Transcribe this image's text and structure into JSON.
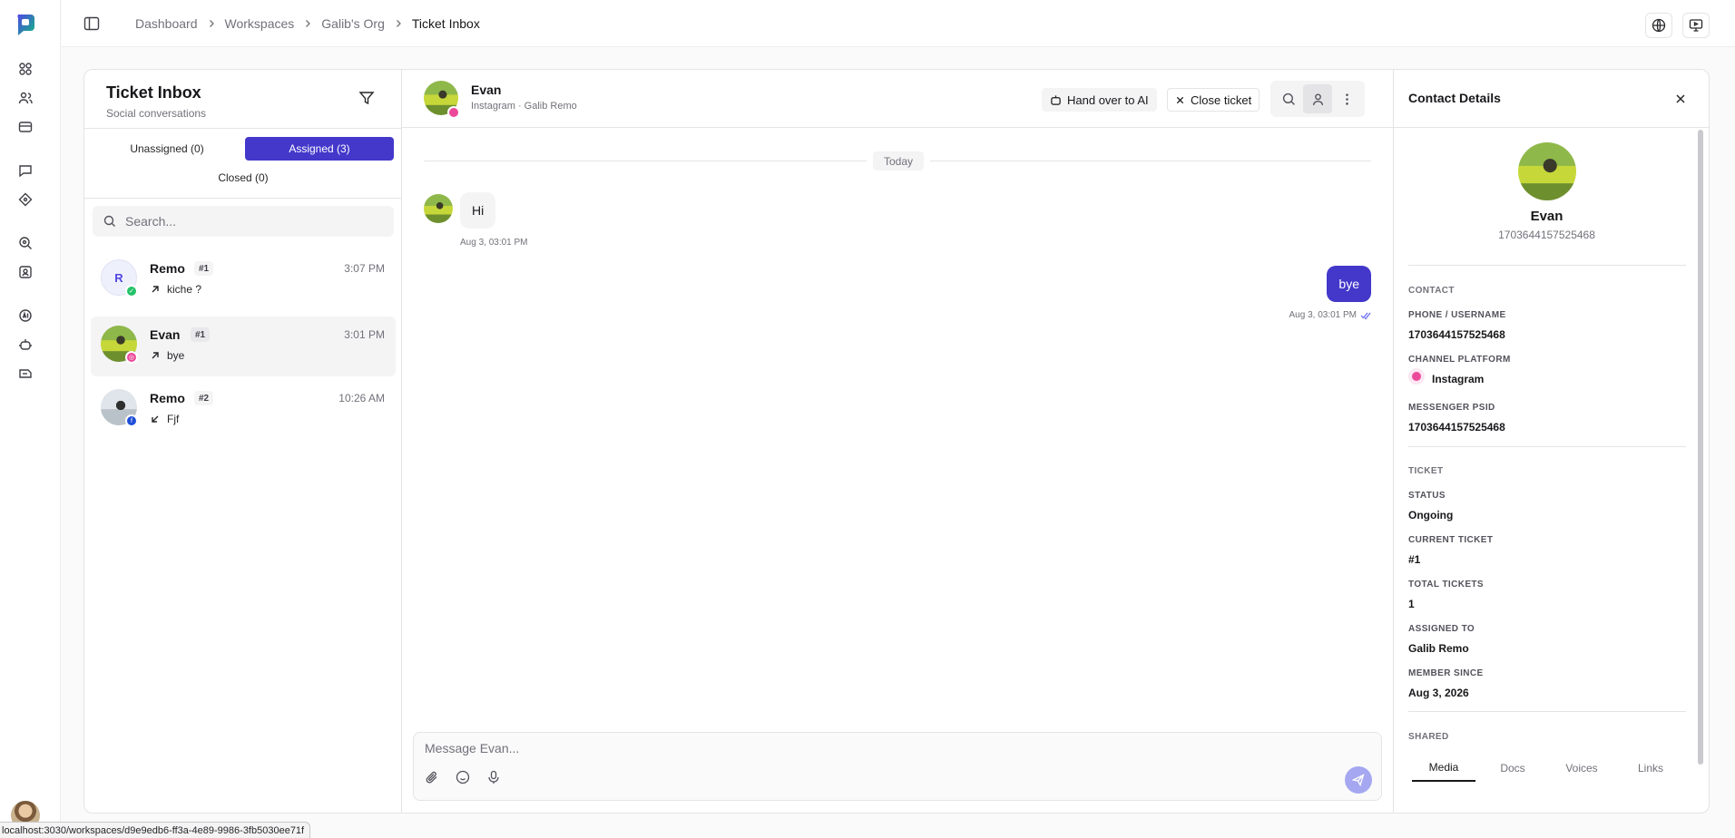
{
  "breadcrumbs": [
    "Dashboard",
    "Workspaces",
    "Galib's Org",
    "Ticket Inbox"
  ],
  "inbox": {
    "title": "Ticket Inbox",
    "subtitle": "Social conversations",
    "tabs": [
      "Unassigned (0)",
      "Assigned (3)",
      "Closed (0)"
    ],
    "active_tab": "Assigned (3)",
    "search_placeholder": "Search...",
    "conversations": [
      {
        "avatar_letter": "R",
        "name": "Remo",
        "ticket": "#1",
        "time": "3:07 PM",
        "preview": "kiche ?",
        "channel": "whatsapp",
        "direction": "outgoing"
      },
      {
        "avatar_letter": "",
        "name": "Evan",
        "ticket": "#1",
        "time": "3:01 PM",
        "preview": "bye",
        "channel": "instagram",
        "direction": "outgoing",
        "selected": true
      },
      {
        "avatar_letter": "",
        "name": "Remo",
        "ticket": "#2",
        "time": "10:26 AM",
        "preview": "Fjf",
        "channel": "facebook",
        "direction": "incoming"
      }
    ]
  },
  "chat": {
    "contact_name": "Evan",
    "contact_sub": "Instagram · Galib Remo",
    "hand_over_label": "Hand over to AI",
    "close_ticket_label": "Close ticket",
    "day_label": "Today",
    "messages": [
      {
        "direction": "in",
        "text": "Hi",
        "timestamp": "Aug 3, 03:01 PM"
      },
      {
        "direction": "out",
        "text": "bye",
        "timestamp": "Aug 3, 03:01 PM"
      }
    ],
    "composer_placeholder": "Message Evan..."
  },
  "details": {
    "title": "Contact Details",
    "name": "Evan",
    "id": "1703644157525468",
    "contact_section": "CONTACT",
    "phone_label": "PHONE / USERNAME",
    "phone_value": "1703644157525468",
    "platform_label": "CHANNEL PLATFORM",
    "platform_value": "Instagram",
    "psid_label": "MESSENGER PSID",
    "psid_value": "1703644157525468",
    "ticket_section": "TICKET",
    "status_label": "STATUS",
    "status_value": "Ongoing",
    "current_ticket_label": "CURRENT TICKET",
    "current_ticket_value": "#1",
    "total_tickets_label": "TOTAL TICKETS",
    "total_tickets_value": "1",
    "assigned_to_label": "ASSIGNED TO",
    "assigned_to_value": "Galib Remo",
    "member_since_label": "MEMBER SINCE",
    "member_since_value": "Aug 3, 2026",
    "shared_section": "SHARED",
    "shared_tabs": [
      "Media",
      "Docs",
      "Voices",
      "Links"
    ],
    "active_shared_tab": "Media"
  },
  "status_bar_url": "localhost:3030/workspaces/d9e9edb6-ff3a-4e89-9986-3fb5030ee71f",
  "colors": {
    "accent": "#4338ca",
    "instagram": "#ec4899",
    "whatsapp": "#25c26a",
    "facebook": "#1d4ed8"
  }
}
